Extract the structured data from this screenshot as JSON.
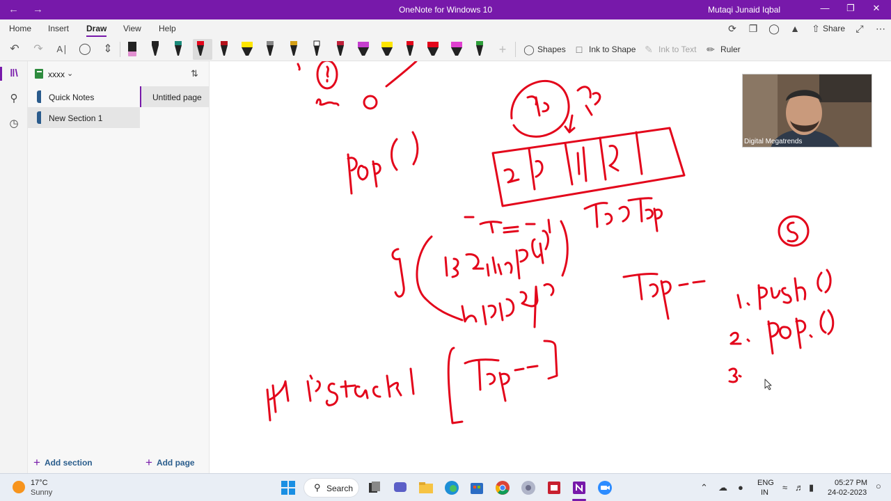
{
  "window": {
    "title": "OneNote for Windows 10",
    "user": "Mutaqi Junaid Iqbal"
  },
  "menu": {
    "home": "Home",
    "insert": "Insert",
    "draw": "Draw",
    "view": "View",
    "help": "Help",
    "share": "Share"
  },
  "toolbar": {
    "shapes": "Shapes",
    "ink_to_shape": "Ink to Shape",
    "ink_to_text": "Ink to Text",
    "ruler": "Ruler"
  },
  "notebook": {
    "name": "xxxx",
    "sections": [
      "Quick Notes",
      "New Section 1"
    ],
    "selected_section": "New Section 1",
    "pages": [
      "Untitled page"
    ],
    "add_section": "Add section",
    "add_page": "Add page"
  },
  "video": {
    "label": "Digital Megatrends"
  },
  "taskbar": {
    "temperature": "17°C",
    "condition": "Sunny",
    "search": "Search",
    "lang_1": "ENG",
    "lang_2": "IN",
    "time": "05:27 PM",
    "date": "24-02-2023"
  },
  "colors": {
    "accent": "#7719aa",
    "ink": "#e3061b",
    "section_tab": "#2a5b8c"
  }
}
